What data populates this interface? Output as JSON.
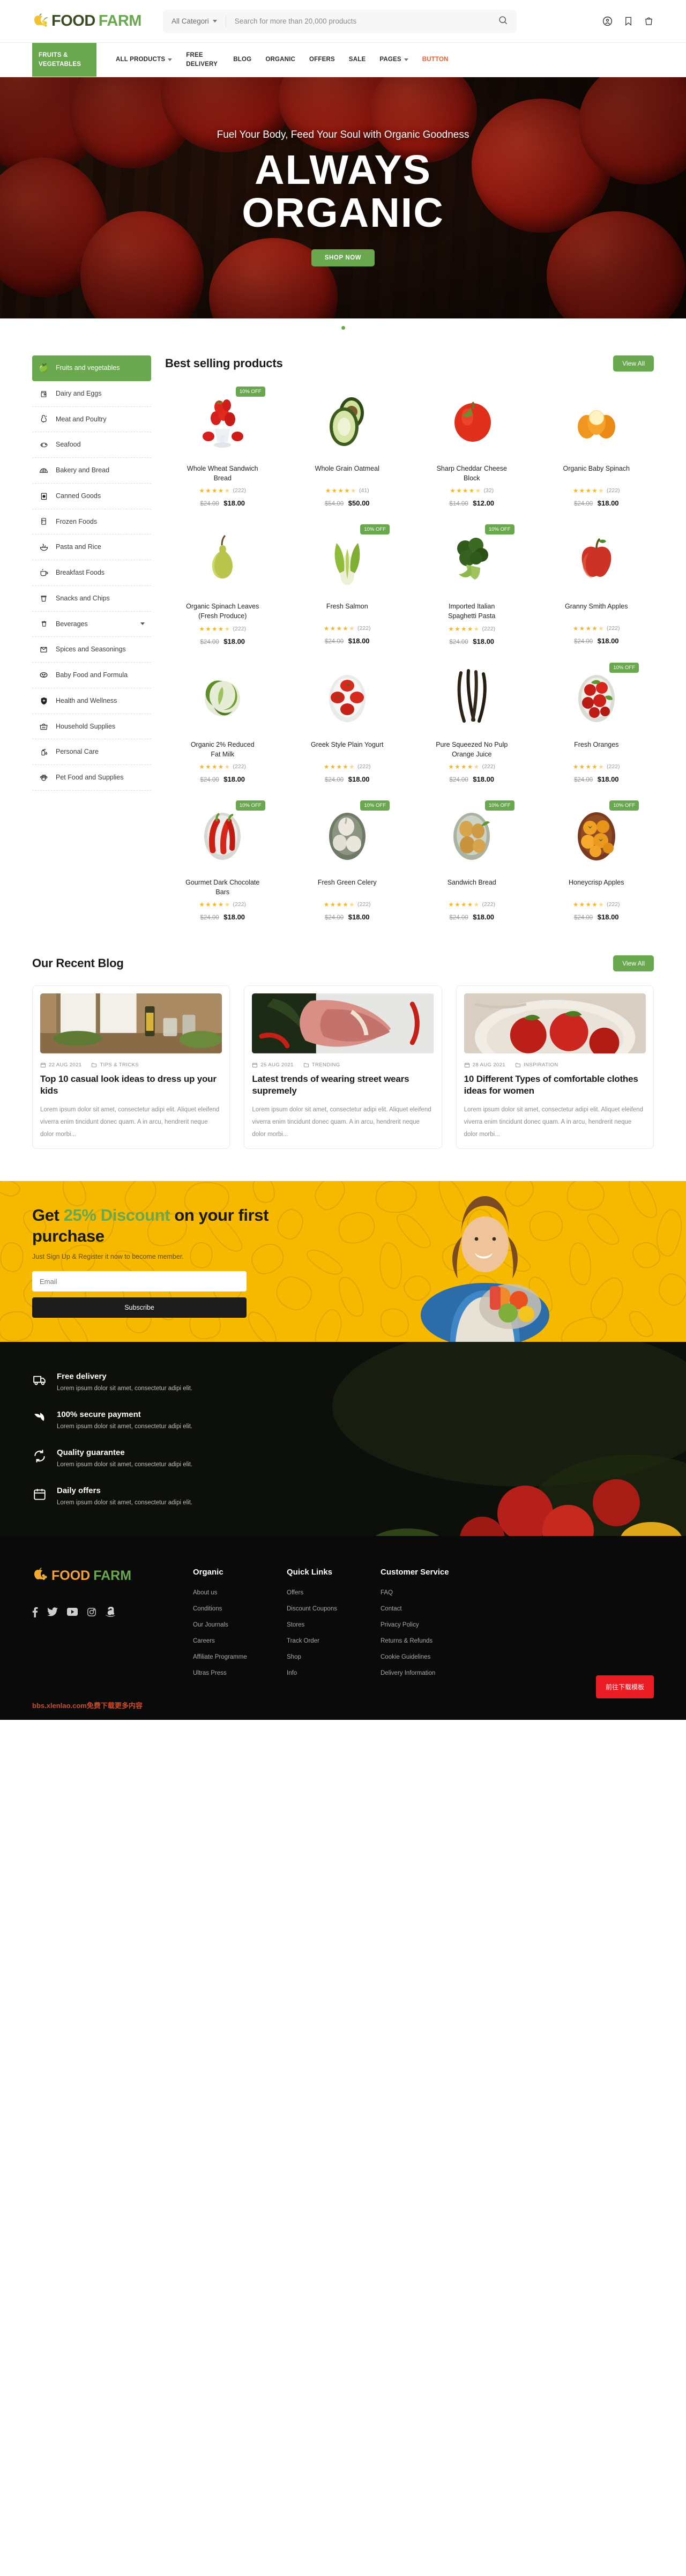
{
  "brand": {
    "part1": "FOOD",
    "part2": "FARM",
    "icon": "apple-grape-icon"
  },
  "header": {
    "category_label": "All Categori",
    "search_placeholder": "Search for more than 20,000 products",
    "search_value": "",
    "icons": [
      "search-icon",
      "user-account-icon",
      "bookmark-icon",
      "cart-icon"
    ]
  },
  "nav": {
    "category_button": "FRUITS & VEGETABLES",
    "items": [
      {
        "label": "ALL PRODUCTS",
        "caret": true
      },
      {
        "label": "FREE DELIVERY",
        "caret": false
      },
      {
        "label": "BLOG",
        "caret": false
      },
      {
        "label": "ORGANIC",
        "caret": false
      },
      {
        "label": "OFFERS",
        "caret": false
      },
      {
        "label": "SALE",
        "caret": false
      },
      {
        "label": "PAGES",
        "caret": true
      },
      {
        "label": "BUTTON",
        "caret": false,
        "accent": true
      }
    ],
    "accent_color": "#f25f2a",
    "green": "#6aa84f"
  },
  "hero": {
    "subtitle": "Fuel Your Body, Feed Your Soul with Organic Goodness",
    "title_line1": "ALWAYS",
    "title_line2": "ORGANIC",
    "cta": "SHOP NOW",
    "slides": 1
  },
  "sidebar": {
    "items": [
      {
        "label": "Fruits and vegetables",
        "icon": "apple-grape-icon",
        "active": true
      },
      {
        "label": "Dairy and Eggs",
        "icon": "milk-carton-icon"
      },
      {
        "label": "Meat and Poultry",
        "icon": "chicken-icon"
      },
      {
        "label": "Seafood",
        "icon": "fish-icon"
      },
      {
        "label": "Bakery and Bread",
        "icon": "croissant-icon"
      },
      {
        "label": "Canned Goods",
        "icon": "can-icon"
      },
      {
        "label": "Frozen Foods",
        "icon": "fridge-icon"
      },
      {
        "label": "Pasta and Rice",
        "icon": "noodle-bowl-icon"
      },
      {
        "label": "Breakfast Foods",
        "icon": "coffee-cup-icon"
      },
      {
        "label": "Snacks and Chips",
        "icon": "chips-cup-icon"
      },
      {
        "label": "Beverages",
        "icon": "drink-cup-icon",
        "chevron": true
      },
      {
        "label": "Spices and Seasonings",
        "icon": "spice-box-icon"
      },
      {
        "label": "Baby Food and Formula",
        "icon": "baby-face-icon"
      },
      {
        "label": "Health and Wellness",
        "icon": "shield-plus-icon"
      },
      {
        "label": "Household Supplies",
        "icon": "basket-icon"
      },
      {
        "label": "Personal Care",
        "icon": "soap-bottle-icon"
      },
      {
        "label": "Pet Food and Supplies",
        "icon": "paw-icon"
      }
    ]
  },
  "products_section": {
    "title": "Best selling products",
    "view_all": "View All",
    "items": [
      {
        "name": "Whole Wheat Sandwich Bread",
        "rating": 4.5,
        "reviews": "(222)",
        "old_price": "$24.00",
        "price": "$18.00",
        "badge": "10% OFF",
        "art": "strawberry-bowl"
      },
      {
        "name": "Whole Grain Oatmeal",
        "rating": 4.5,
        "reviews": "(41)",
        "old_price": "$54.00",
        "price": "$50.00",
        "badge": "",
        "art": "avocado"
      },
      {
        "name": "Sharp Cheddar Cheese Block",
        "rating": 4.5,
        "reviews": "(32)",
        "old_price": "$14.00",
        "price": "$12.00",
        "badge": "",
        "art": "red-pepper"
      },
      {
        "name": "Organic Baby Spinach",
        "rating": 4.5,
        "reviews": "(222)",
        "old_price": "$24.00",
        "price": "$18.00",
        "badge": "",
        "art": "oranges"
      },
      {
        "name": "Organic Spinach Leaves (Fresh Produce)",
        "rating": 4.5,
        "reviews": "(222)",
        "old_price": "$24.00",
        "price": "$18.00",
        "badge": "",
        "art": "pear"
      },
      {
        "name": "Fresh Salmon",
        "rating": 4.5,
        "reviews": "(222)",
        "old_price": "$24.00",
        "price": "$18.00",
        "badge": "10% OFF",
        "art": "bok-choy"
      },
      {
        "name": "Imported Italian Spaghetti Pasta",
        "rating": 4.5,
        "reviews": "(222)",
        "old_price": "$24.00",
        "price": "$18.00",
        "badge": "10% OFF",
        "art": "broccoli"
      },
      {
        "name": "Granny Smith Apples",
        "rating": 4.5,
        "reviews": "(222)",
        "old_price": "$24.00",
        "price": "$18.00",
        "badge": "",
        "art": "apple"
      },
      {
        "name": "Organic 2% Reduced Fat Milk",
        "rating": 4.5,
        "reviews": "(222)",
        "old_price": "$24.00",
        "price": "$18.00",
        "badge": "",
        "art": "cabbage"
      },
      {
        "name": "Greek Style Plain Yogurt",
        "rating": 4.5,
        "reviews": "(222)",
        "old_price": "$24.00",
        "price": "$18.00",
        "badge": "",
        "art": "tomato-plate"
      },
      {
        "name": "Pure Squeezed No Pulp Orange Juice",
        "rating": 4.5,
        "reviews": "(222)",
        "old_price": "$24.00",
        "price": "$18.00",
        "badge": "",
        "art": "beans"
      },
      {
        "name": "Fresh Oranges",
        "rating": 4.5,
        "reviews": "(222)",
        "old_price": "$24.00",
        "price": "$18.00",
        "badge": "10% OFF",
        "art": "radish-bowl"
      },
      {
        "name": "Gourmet Dark Chocolate Bars",
        "rating": 4.5,
        "reviews": "(222)",
        "old_price": "$24.00",
        "price": "$18.00",
        "badge": "10% OFF",
        "art": "chili-bowl"
      },
      {
        "name": "Fresh Green Celery",
        "rating": 4.5,
        "reviews": "(222)",
        "old_price": "$24.00",
        "price": "$18.00",
        "badge": "10% OFF",
        "art": "garlic-bowl"
      },
      {
        "name": "Sandwich Bread",
        "rating": 4.5,
        "reviews": "(222)",
        "old_price": "$24.00",
        "price": "$18.00",
        "badge": "10% OFF",
        "art": "onion-bowl"
      },
      {
        "name": "Honeycrisp Apples",
        "rating": 4.5,
        "reviews": "(222)",
        "old_price": "$24.00",
        "price": "$18.00",
        "badge": "10% OFF",
        "art": "persimmon-bowl"
      }
    ]
  },
  "blog_section": {
    "title": "Our Recent Blog",
    "view_all": "View All",
    "posts": [
      {
        "date": "22 AUG 2021",
        "tag": "TIPS & TRICKS",
        "title": "Top 10 casual look ideas to dress up your kids",
        "excerpt": "Lorem ipsum dolor sit amet, consectetur adipi elit. Aliquet eleifend viverra enim tincidunt donec quam. A in arcu, hendrerit neque dolor morbi...",
        "image": "kitchen-table"
      },
      {
        "date": "25 AUG 2021",
        "tag": "TRENDING",
        "title": "Latest trends of wearing street wears supremely",
        "excerpt": "Lorem ipsum dolor sit amet, consectetur adipi elit. Aliquet eleifend viverra enim tincidunt donec quam. A in arcu, hendrerit neque dolor morbi...",
        "image": "raw-steak"
      },
      {
        "date": "28 AUG 2021",
        "tag": "INSPIRATION",
        "title": "10 Different Types of comfortable clothes ideas for women",
        "excerpt": "Lorem ipsum dolor sit amet, consectetur adipi elit. Aliquet eleifend viverra enim tincidunt donec quam. A in arcu, hendrerit neque dolor morbi...",
        "image": "tomato-bag"
      }
    ]
  },
  "promo": {
    "title_a": "Get ",
    "title_highlight": "25% Discount",
    "title_b": " on your first purchase",
    "subtitle": "Just Sign Up & Register it now to become member.",
    "email_placeholder": "Email",
    "email_value": "",
    "subscribe": "Subscribe",
    "bg_color": "#f6b900",
    "highlight_color": "#6aa84f"
  },
  "features": [
    {
      "icon": "truck-icon",
      "title": "Free delivery",
      "desc": "Lorem ipsum dolor sit amet, consectetur adipi elit."
    },
    {
      "icon": "leaf-icon",
      "title": "100% secure payment",
      "desc": "Lorem ipsum dolor sit amet, consectetur adipi elit."
    },
    {
      "icon": "refresh-icon",
      "title": "Quality guarantee",
      "desc": "Lorem ipsum dolor sit amet, consectetur adipi elit."
    },
    {
      "icon": "calendar-icon",
      "title": "Daily offers",
      "desc": "Lorem ipsum dolor sit amet, consectetur adipi elit."
    }
  ],
  "footer": {
    "socials": [
      "facebook-icon",
      "twitter-icon",
      "youtube-icon",
      "instagram-icon",
      "amazon-icon"
    ],
    "columns": [
      {
        "heading": "Organic",
        "links": [
          "About us",
          "Conditions",
          "Our Journals",
          "Careers",
          "Affiliate Programme",
          "Ultras Press"
        ]
      },
      {
        "heading": "Quick Links",
        "links": [
          "Offers",
          "Discount Coupons",
          "Stores",
          "Track Order",
          "Shop",
          "Info"
        ]
      },
      {
        "heading": "Customer Service",
        "links": [
          "FAQ",
          "Contact",
          "Privacy Policy",
          "Returns & Refunds",
          "Cookie Guidelines",
          "Delivery Information"
        ]
      }
    ],
    "watermark": "bbs.xlenlao.com免费下载更多内容",
    "download_button": "前往下载模板"
  }
}
